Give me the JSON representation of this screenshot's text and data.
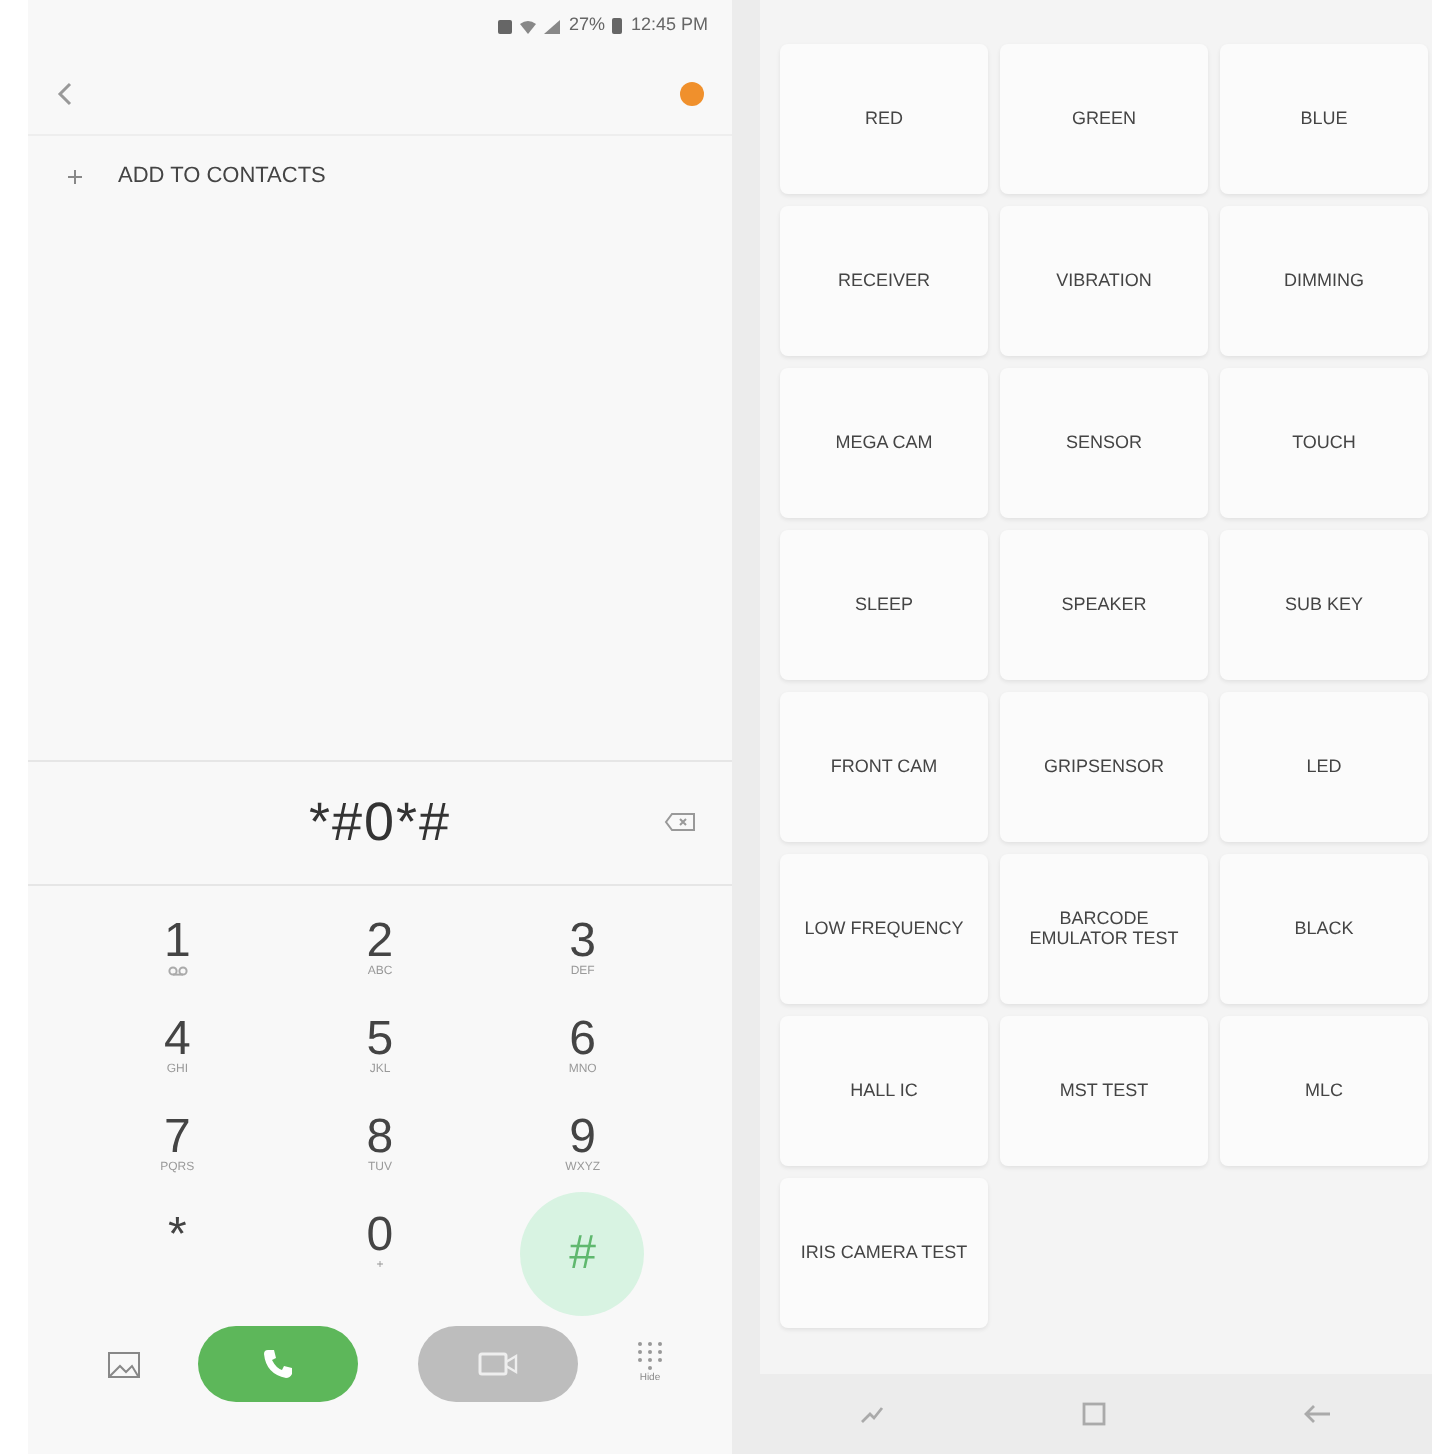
{
  "status_bar": {
    "battery": "27%",
    "time": "12:45 PM"
  },
  "header": {
    "badge": true
  },
  "add_contacts": {
    "label": "ADD TO CONTACTS"
  },
  "dial_display": {
    "value": "*#0*#"
  },
  "keypad": [
    {
      "digit": "1",
      "kind": "voicemail",
      "selected": false
    },
    {
      "digit": "2",
      "letters": "ABC",
      "kind": "letters",
      "selected": false
    },
    {
      "digit": "3",
      "letters": "DEF",
      "kind": "letters",
      "selected": false
    },
    {
      "digit": "4",
      "letters": "GHI",
      "kind": "letters",
      "selected": false
    },
    {
      "digit": "5",
      "letters": "JKL",
      "kind": "letters",
      "selected": false
    },
    {
      "digit": "6",
      "letters": "MNO",
      "kind": "letters",
      "selected": false
    },
    {
      "digit": "7",
      "letters": "PQRS",
      "kind": "letters",
      "selected": false
    },
    {
      "digit": "8",
      "letters": "TUV",
      "kind": "letters",
      "selected": false
    },
    {
      "digit": "9",
      "letters": "WXYZ",
      "kind": "letters",
      "selected": false
    },
    {
      "digit": "*",
      "kind": "plain",
      "selected": false
    },
    {
      "digit": "0",
      "letters": "+",
      "kind": "letters",
      "selected": false
    },
    {
      "digit": "#",
      "kind": "plain",
      "selected": true
    }
  ],
  "bottom_bar": {
    "hide_label": "Hide"
  },
  "test_menu": [
    "RED",
    "GREEN",
    "BLUE",
    "RECEIVER",
    "VIBRATION",
    "DIMMING",
    "MEGA CAM",
    "SENSOR",
    "TOUCH",
    "SLEEP",
    "SPEAKER",
    "SUB KEY",
    "FRONT CAM",
    "GRIPSENSOR",
    "LED",
    "LOW FREQUENCY",
    "BARCODE EMULATOR TEST",
    "BLACK",
    "HALL IC",
    "MST TEST",
    "MLC",
    "IRIS CAMERA TEST"
  ]
}
